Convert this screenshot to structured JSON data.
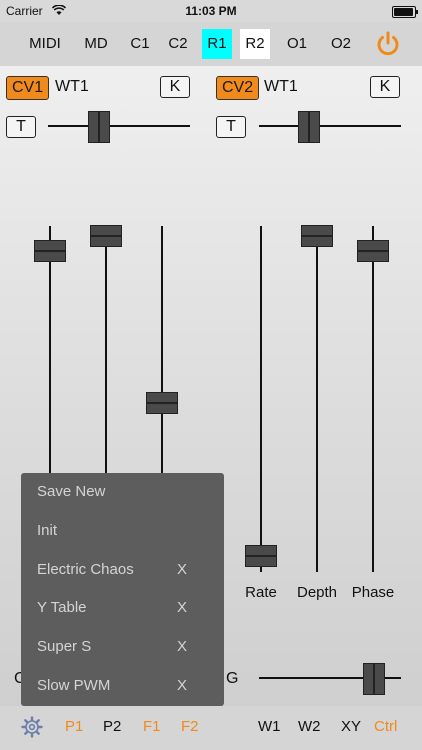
{
  "status": {
    "carrier": "Carrier",
    "time": "11:03 PM"
  },
  "top_tabs": [
    {
      "label": "MIDI"
    },
    {
      "label": "MD"
    },
    {
      "label": "C1"
    },
    {
      "label": "C2"
    },
    {
      "label": "R1",
      "highlight": "#00ffff"
    },
    {
      "label": "R2",
      "highlight": "#ffffff"
    },
    {
      "label": "O1"
    },
    {
      "label": "O2"
    }
  ],
  "cv1": {
    "badge": "CV1",
    "name": "WT1",
    "k_label": "K",
    "t_label": "T",
    "slider_value": 0.38
  },
  "cv2": {
    "badge": "CV2",
    "name": "WT1",
    "k_label": "K",
    "t_label": "T",
    "slider_value": 0.38
  },
  "sliders": {
    "rate_label": "Rate",
    "depth_label": "Depth",
    "phase_label": "Phase"
  },
  "bottom_left_partial_label": "C",
  "bottom_mid_partial_label": "G",
  "menu": {
    "items": [
      {
        "label": "Save New",
        "x": ""
      },
      {
        "label": "Init",
        "x": ""
      },
      {
        "label": "Electric Chaos",
        "x": "X"
      },
      {
        "label": "Y Table",
        "x": "X"
      },
      {
        "label": "Super S",
        "x": "X"
      },
      {
        "label": "Slow PWM",
        "x": "X"
      }
    ]
  },
  "bottom_tabs": {
    "p1": "P1",
    "p2": "P2",
    "f1": "F1",
    "f2": "F2",
    "w1": "W1",
    "w2": "W2",
    "xy": "XY",
    "ctrl": "Ctrl"
  },
  "colors": {
    "accent": "#f08a1c",
    "cyan": "#00ffff"
  }
}
